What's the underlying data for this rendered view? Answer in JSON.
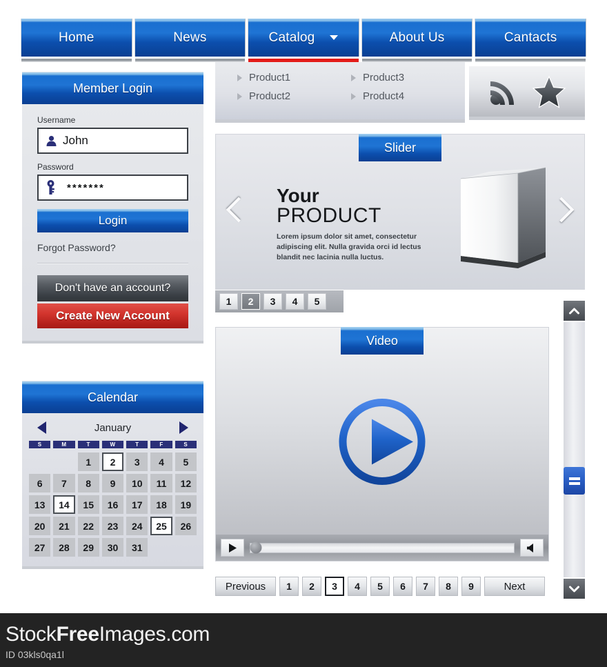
{
  "nav": {
    "items": [
      {
        "label": "Home",
        "active": false,
        "has_caret": false
      },
      {
        "label": "News",
        "active": false,
        "has_caret": false
      },
      {
        "label": "Catalog",
        "active": true,
        "has_caret": true
      },
      {
        "label": "About Us",
        "active": false,
        "has_caret": false
      },
      {
        "label": "Cantacts",
        "active": false,
        "has_caret": false
      }
    ],
    "active_accent": "#e31b17"
  },
  "dropdown": {
    "items": [
      "Product1",
      "Product2",
      "Product3",
      "Product4"
    ]
  },
  "social": {
    "icons": [
      "rss-icon",
      "star-icon"
    ]
  },
  "login": {
    "title": "Member Login",
    "username_label": "Username",
    "username_value": "John",
    "username_icon": "user-icon",
    "password_label": "Password",
    "password_value": "*******",
    "password_icon": "key-icon",
    "login_button": "Login",
    "forgot_link": "Forgot Password?",
    "no_account_button": "Don't have an account?",
    "create_account_button": "Create New Account",
    "create_account_color": "#c52a24"
  },
  "calendar": {
    "title": "Calendar",
    "month": "January",
    "prev_icon": "arrow-left-icon",
    "next_icon": "arrow-right-icon",
    "dow": [
      "S",
      "M",
      "T",
      "W",
      "T",
      "F",
      "S"
    ],
    "lead_blank": 2,
    "days": [
      1,
      2,
      3,
      4,
      5,
      6,
      7,
      8,
      9,
      10,
      11,
      12,
      13,
      14,
      15,
      16,
      17,
      18,
      19,
      20,
      21,
      22,
      23,
      24,
      25,
      26,
      27,
      28,
      29,
      30,
      31
    ],
    "selected": [
      2,
      14,
      25
    ]
  },
  "slider": {
    "tab_label": "Slider",
    "heading_top": "Your",
    "heading_bottom": "PRODUCT",
    "body": "Lorem ipsum dolor sit amet, consectetur adipiscing elit. Nulla gravida orci id lectus blandit nec lacinia nulla luctus.",
    "prev_icon": "chevron-left-icon",
    "next_icon": "chevron-right-icon",
    "product_image": "product-box-3d",
    "pager": [
      "1",
      "2",
      "3",
      "4",
      "5"
    ],
    "pager_active": "2"
  },
  "video": {
    "tab_label": "Video",
    "play_icon": "play-circle-icon",
    "controls": {
      "play_icon": "play-icon",
      "mute_icon": "speaker-icon",
      "progress_percent": 1
    }
  },
  "pagination": {
    "previous_label": "Previous",
    "next_label": "Next",
    "pages": [
      "1",
      "2",
      "3",
      "4",
      "5",
      "6",
      "7",
      "8",
      "9"
    ],
    "active": "3"
  },
  "scrollbar": {
    "up_icon": "chevron-up-icon",
    "down_icon": "chevron-down-icon",
    "thumb_icon": "grip-lines-icon"
  },
  "footer": {
    "brand_pre": "Stock",
    "brand_mid": "Free",
    "brand_post": "Images.com",
    "id": "ID 03kls0qa1l"
  }
}
